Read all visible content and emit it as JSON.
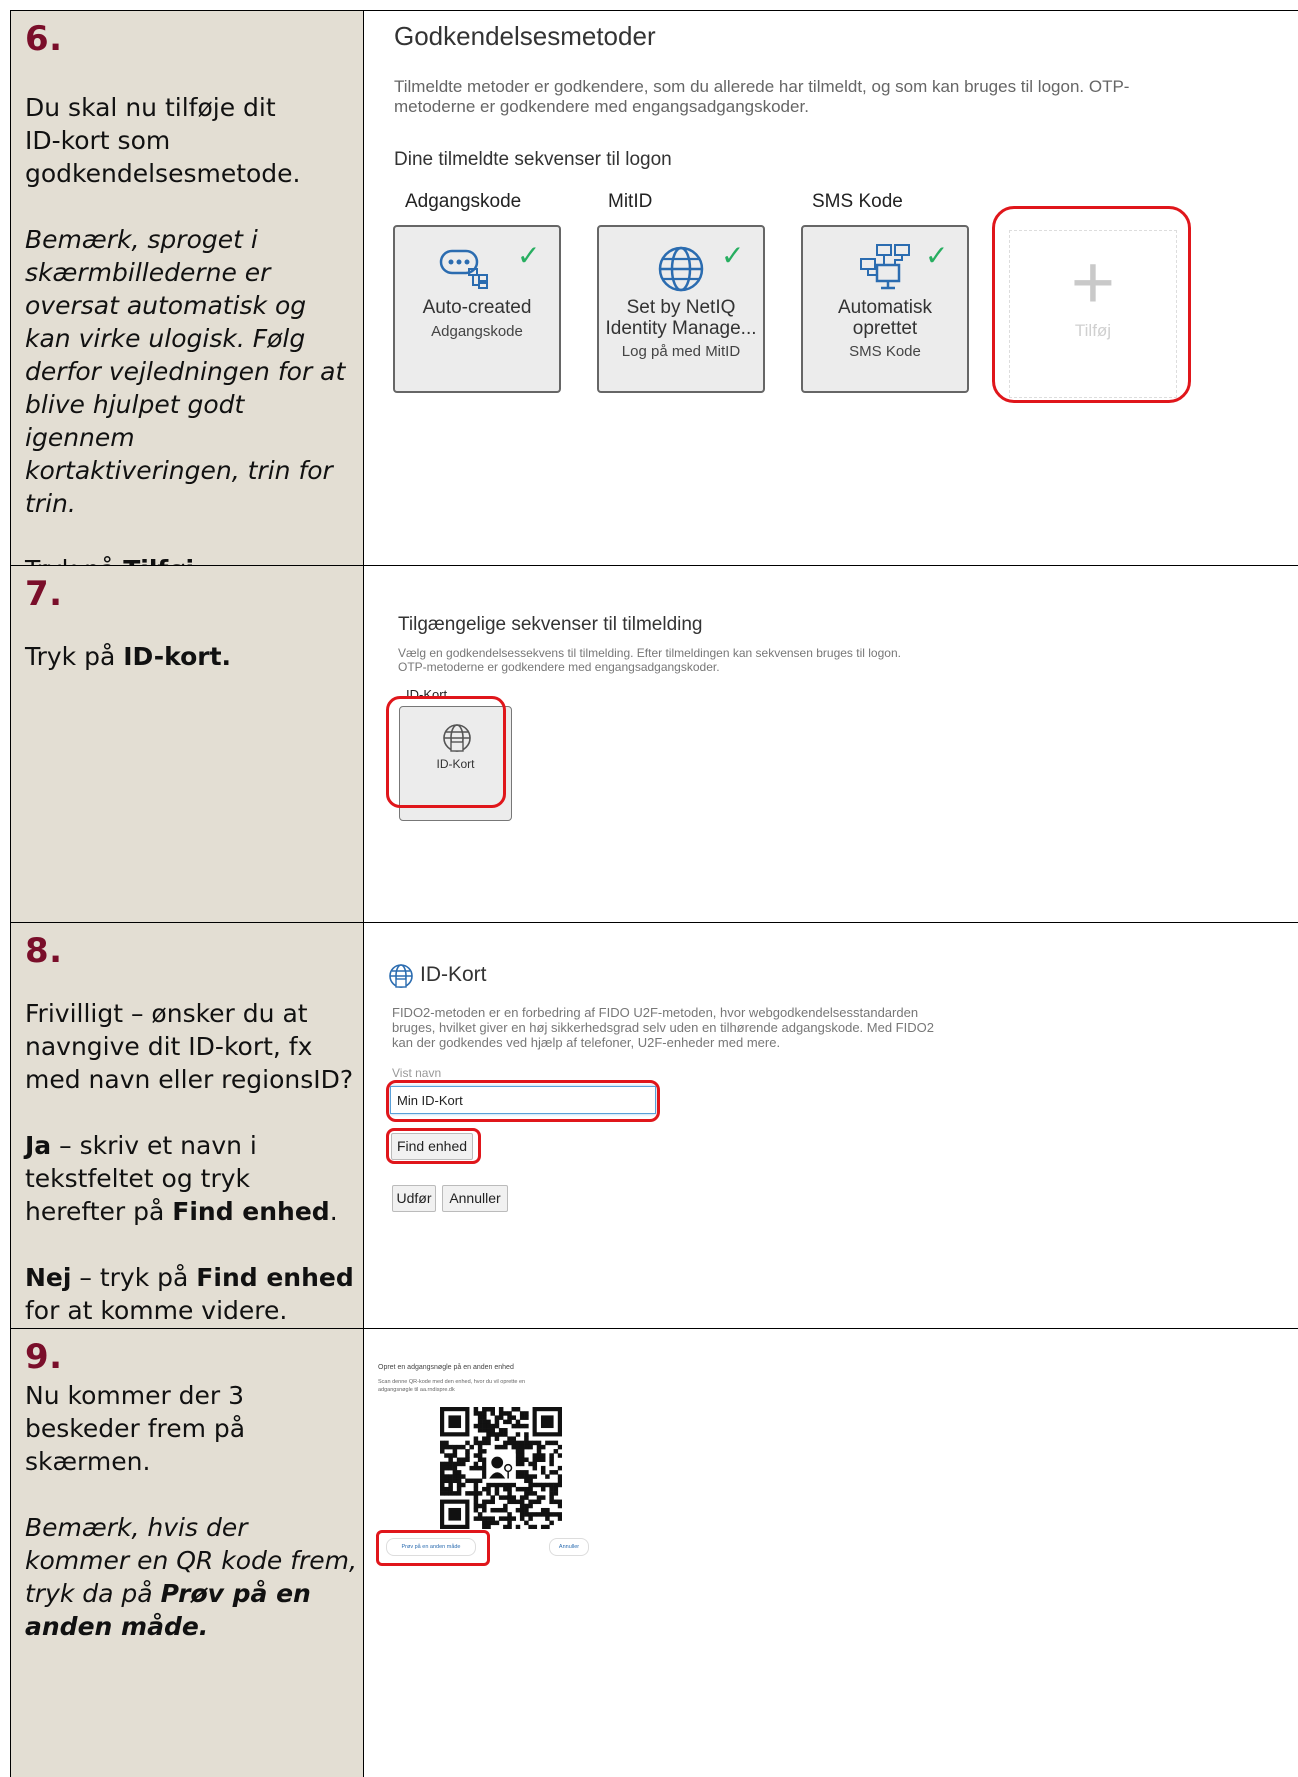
{
  "steps": [
    {
      "number": "6.",
      "left": {
        "p1": [
          "Du skal nu tilføje dit",
          "ID-kort som",
          "godkendelsesmetode."
        ],
        "p2": [
          "Bemærk, sproget i",
          "skærmbillederne er",
          "oversat automatisk og",
          "kan virke ulogisk. Følg",
          "derfor vejledningen for at",
          "blive hjulpet godt",
          "igennem",
          "kortaktiveringen, trin for",
          "trin."
        ],
        "p3_pre": "Tryk på ",
        "p3_bold": "Tilføj",
        "p3_post": "."
      },
      "screen": {
        "title": "Godkendelsesmetoder",
        "desc_line1": "Tilmeldte metoder er godkendere, som du allerede har tilmeldt, og som kan bruges til logon. OTP-",
        "desc_line2": "metoderne er godkendere med engangsadgangskoder.",
        "subtitle": "Dine tilmeldte sekvenser til logon",
        "methods": [
          {
            "header": "Adgangskode",
            "line1": "Auto-created",
            "line2": "",
            "sub": "Adgangskode",
            "icon": "password-chat-icon"
          },
          {
            "header": "MitID",
            "line1": "Set by NetIQ",
            "line2": "Identity Manage...",
            "sub": "Log på med MitID",
            "icon": "globe-icon"
          },
          {
            "header": "SMS Kode",
            "line1": "Automatisk",
            "line2": "oprettet",
            "sub": "SMS Kode",
            "icon": "network-icon"
          }
        ],
        "add_label": "Tilføj",
        "check_glyph": "✓",
        "plus_glyph": "+"
      }
    },
    {
      "number": "7.",
      "left": {
        "pre": "Tryk på ",
        "bold": "ID-kort."
      },
      "screen": {
        "title": "Tilgængelige sekvenser til tilmelding",
        "desc_line1": "Vælg en godkendelsessekvens til tilmelding. Efter tilmeldingen kan sekvensen bruges til logon.",
        "desc_line2": "OTP-metoderne er godkendere med engangsadgangskoder.",
        "card_header": "ID-Kort",
        "card_label": "ID-Kort"
      }
    },
    {
      "number": "8.",
      "left": {
        "p1": [
          "Frivilligt – ønsker du at",
          "navngive dit ID-kort, fx",
          "med navn eller regionsID?"
        ],
        "p2_bold1": "Ja",
        "p2_line1": " – skriv et navn i",
        "p2_line2": "tekstfeltet og tryk",
        "p2_line3_pre": "herefter på ",
        "p2_line3_bold": "Find enhed",
        "p2_line3_post": ".",
        "p3_bold1": "Nej",
        "p3_line1_mid": " – tryk på ",
        "p3_line1_bold": "Find enhed",
        "p3_line2": "for at komme videre."
      },
      "screen": {
        "title": "ID-Kort",
        "desc_line1": "FIDO2-metoden er en forbedring af FIDO U2F-metoden, hvor webgodkendelsesstandarden",
        "desc_line2": "bruges, hvilket giver en høj sikkerhedsgrad selv uden en tilhørende adgangskode. Med FIDO2",
        "desc_line3": "kan der godkendes ved hjælp af telefoner, U2F-enheder med mere.",
        "field_label": "Vist navn",
        "field_value": "Min ID-Kort",
        "find_button": "Find enhed",
        "submit_button": "Udfør",
        "cancel_button": "Annuller"
      }
    },
    {
      "number": "9.",
      "left": {
        "p1": [
          "Nu kommer der 3",
          "beskeder frem på",
          "skærmen."
        ],
        "p2": [
          "Bemærk, hvis der",
          "kommer en QR kode frem,"
        ],
        "p2_pre": "tryk da på ",
        "p2_bold_line1": "Prøv på en",
        "p2_bold_line2": "anden måde."
      },
      "screen": {
        "title": "Opret en adgangsnøgle på en anden enhed",
        "desc_line1": "Scan denne QR-kode med den enhed, hvor du vil oprette en",
        "desc_line2": "adgangsnøgle til aa.rndispre.dk",
        "other_way_button": "Prøv på en anden måde",
        "cancel_button": "Annuller"
      }
    }
  ],
  "colors": {
    "step_number": "#7a0e2a",
    "left_bg": "#e3ded3",
    "highlight": "#e0161b",
    "check": "#27ae60"
  }
}
